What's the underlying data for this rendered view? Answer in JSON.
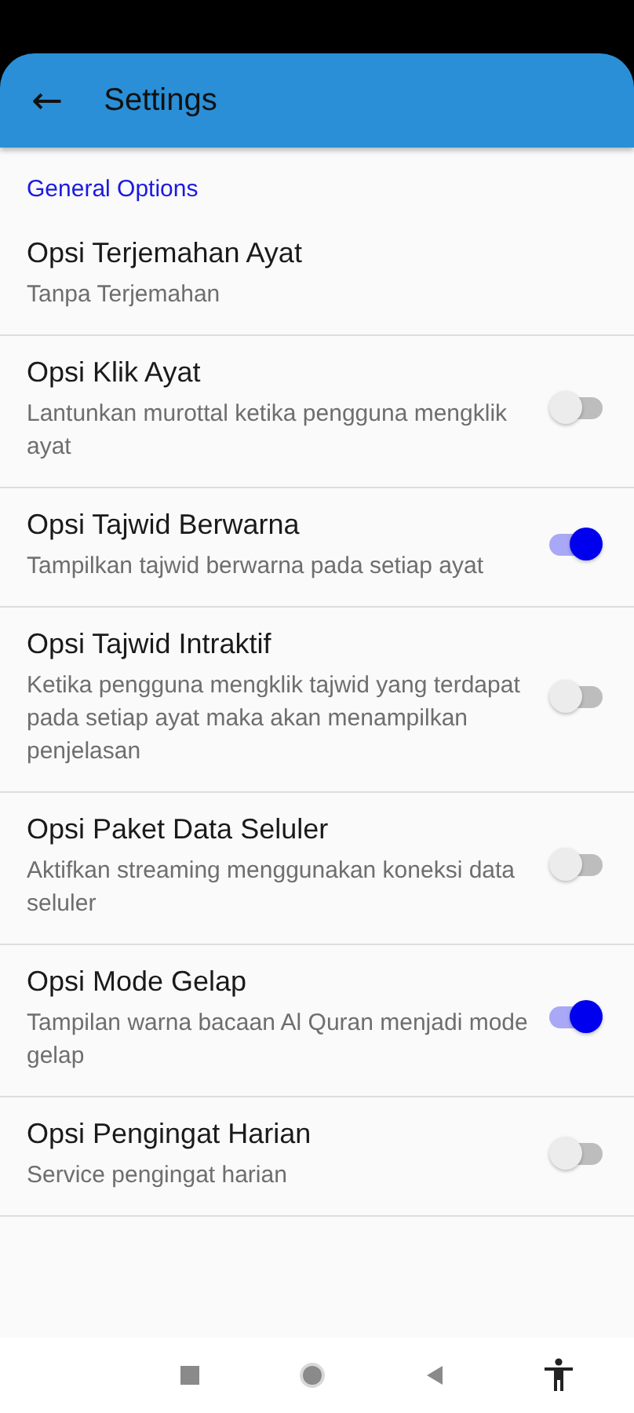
{
  "app_bar": {
    "back_icon": "←",
    "title": "Settings"
  },
  "section": {
    "title": "General Options"
  },
  "options": [
    {
      "kind": "value",
      "title": "Opsi Terjemahan Ayat",
      "summary": "Tanpa Terjemahan"
    },
    {
      "kind": "switch",
      "title": "Opsi Klik Ayat",
      "summary": "Lantunkan murottal ketika pengguna mengklik ayat",
      "on": false
    },
    {
      "kind": "switch",
      "title": "Opsi Tajwid Berwarna",
      "summary": "Tampilkan tajwid berwarna pada setiap ayat",
      "on": true
    },
    {
      "kind": "switch",
      "title": "Opsi Tajwid Intraktif",
      "summary": "Ketika pengguna mengklik tajwid yang terdapat pada setiap ayat maka akan menampilkan penjelasan",
      "on": false
    },
    {
      "kind": "switch",
      "title": "Opsi Paket Data Seluler",
      "summary": "Aktifkan streaming menggunakan koneksi data seluler",
      "on": false
    },
    {
      "kind": "switch",
      "title": "Opsi Mode Gelap",
      "summary": "Tampilan warna bacaan Al Quran menjadi mode gelap",
      "on": true
    },
    {
      "kind": "switch",
      "title": "Opsi Pengingat Harian",
      "summary": "Service pengingat harian",
      "on": false
    }
  ]
}
